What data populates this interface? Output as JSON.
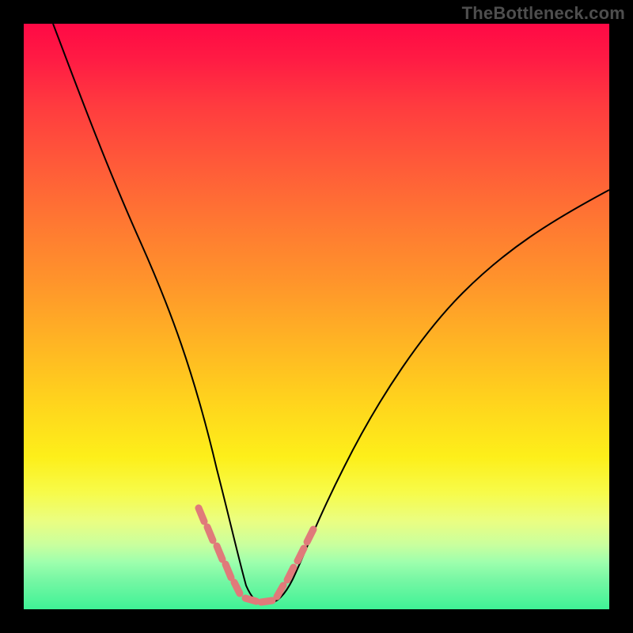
{
  "watermark": "TheBottleneck.com",
  "chart_data": {
    "type": "line",
    "title": "",
    "xlabel": "",
    "ylabel": "",
    "xlim": [
      0,
      100
    ],
    "ylim": [
      0,
      100
    ],
    "grid": false,
    "background": "vertical gradient red (top) → orange → yellow → green (bottom), representing high-to-low bottleneck",
    "series": [
      {
        "name": "bottleneck-curve",
        "x": [
          5,
          10,
          15,
          20,
          25,
          30,
          33,
          36,
          38,
          40,
          42,
          45,
          50,
          55,
          60,
          65,
          70,
          75,
          80,
          85,
          90,
          95,
          100
        ],
        "y": [
          100,
          88,
          76,
          63,
          48,
          32,
          20,
          10,
          4,
          1,
          1,
          4,
          12,
          22,
          31,
          39,
          47,
          53,
          58,
          63,
          67,
          70,
          72
        ],
        "note": "y is read as percentage of plot height from bottom; values estimated from curve depth within the gradient"
      }
    ],
    "markers": [
      {
        "name": "salmon-dashes-group",
        "color": "#e07a7a",
        "shape": "short-diagonal-dash",
        "points": [
          {
            "x": 30,
            "y": 16
          },
          {
            "x": 31.5,
            "y": 13
          },
          {
            "x": 33,
            "y": 9
          },
          {
            "x": 34.5,
            "y": 5
          },
          {
            "x": 36,
            "y": 3
          },
          {
            "x": 38,
            "y": 1.5
          },
          {
            "x": 40,
            "y": 1
          },
          {
            "x": 42,
            "y": 1.5
          },
          {
            "x": 44,
            "y": 3
          },
          {
            "x": 46,
            "y": 6
          },
          {
            "x": 47.5,
            "y": 9
          },
          {
            "x": 49,
            "y": 12
          }
        ]
      }
    ]
  }
}
